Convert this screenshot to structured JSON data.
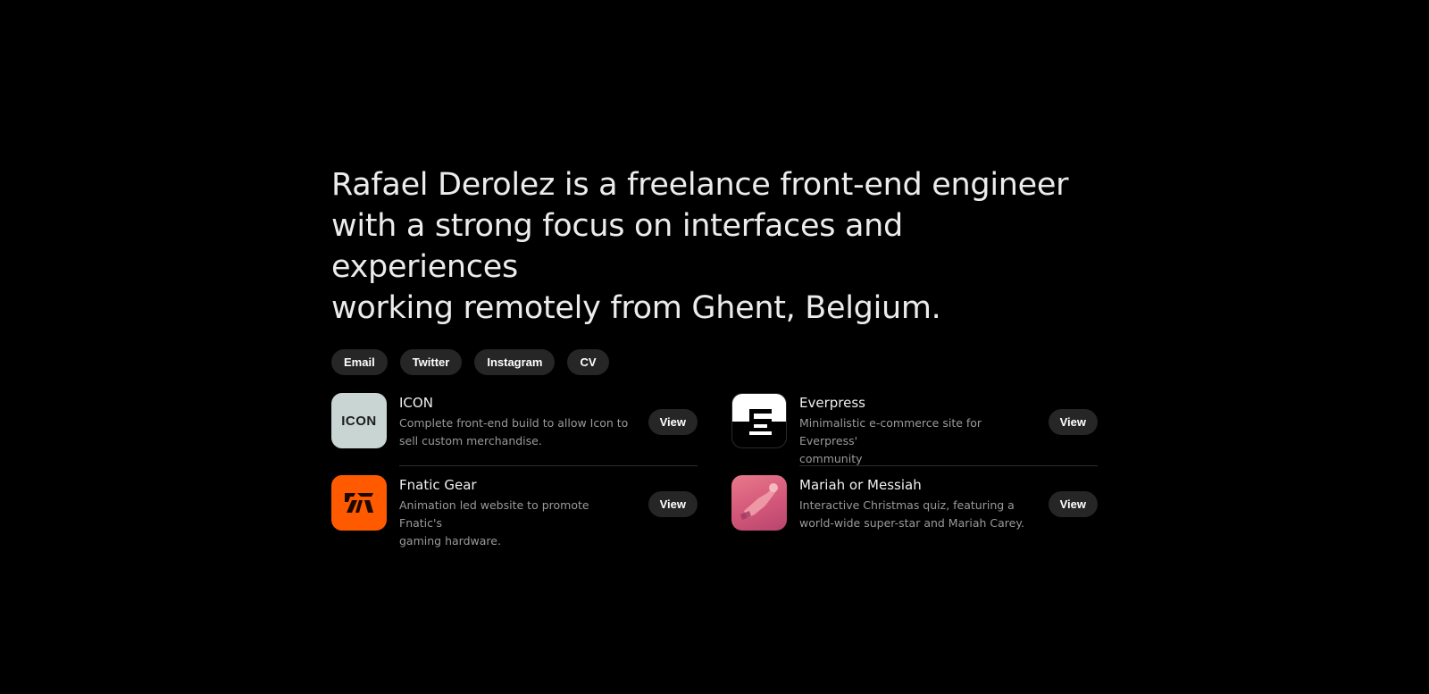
{
  "intro": {
    "line1": "Rafael Derolez is a freelance front-end engineer",
    "line2": "with a strong focus on interfaces and experiences",
    "line3": "working remotely from Ghent, Belgium."
  },
  "links": [
    "Email",
    "Twitter",
    "Instagram",
    "CV"
  ],
  "projects": [
    {
      "title": "ICON",
      "desc_line1": "Complete front-end build to allow Icon to",
      "desc_line2": "sell custom merchandise.",
      "logo_text": "ICON",
      "action": "View"
    },
    {
      "title": "Everpress",
      "desc_line1": "Minimalistic e-commerce site for Everpress'",
      "desc_line2": "community",
      "action": "View"
    },
    {
      "title": "Fnatic Gear",
      "desc_line1": "Animation led website to promote Fnatic's",
      "desc_line2": "gaming hardware.",
      "action": "View"
    },
    {
      "title": "Mariah or Messiah",
      "desc_line1": "Interactive Christmas quiz, featuring a",
      "desc_line2": "world-wide super-star and Mariah Carey.",
      "action": "View"
    }
  ],
  "colors": {
    "background": "#000000",
    "pill": "#262626",
    "icon_bg": "#c9d5d3",
    "fnatic": "#ff5a00",
    "mariah": "#d4577a"
  }
}
